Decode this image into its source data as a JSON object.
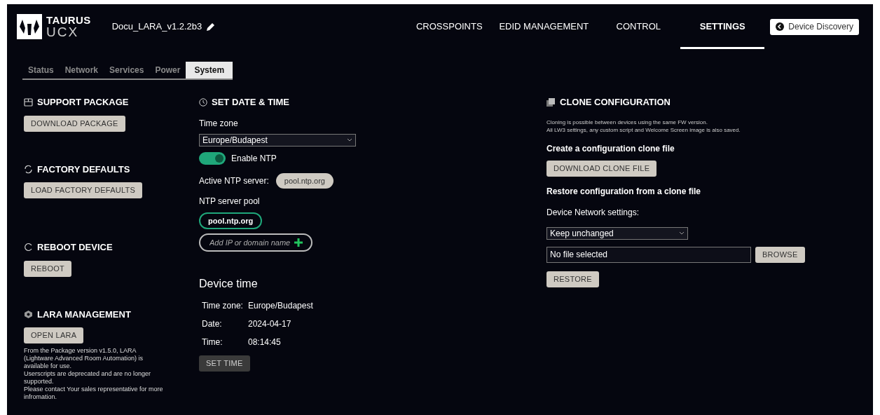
{
  "header": {
    "logo_top": "TAURUS",
    "logo_bottom": "UCX",
    "device_name": "Docu_LARA_v1.2.2b3",
    "nav": [
      {
        "label": "CROSSPOINTS",
        "selected": false
      },
      {
        "label": "EDID MANAGEMENT",
        "selected": false
      },
      {
        "label": "CONTROL",
        "selected": false
      },
      {
        "label": "SETTINGS",
        "selected": true
      }
    ],
    "discovery_button": "Device Discovery"
  },
  "subtabs": [
    {
      "label": "Status",
      "selected": false
    },
    {
      "label": "Network",
      "selected": false
    },
    {
      "label": "Services",
      "selected": false
    },
    {
      "label": "Power",
      "selected": false
    },
    {
      "label": "System",
      "selected": true
    }
  ],
  "left_sections": [
    {
      "kind": "package",
      "title": "SUPPORT PACKAGE",
      "button": "DOWNLOAD PACKAGE"
    },
    {
      "kind": "factory",
      "title": "FACTORY DEFAULTS",
      "button": "LOAD FACTORY DEFAULTS"
    },
    {
      "kind": "reboot",
      "title": "REBOOT DEVICE",
      "button": "REBOOT"
    },
    {
      "kind": "lara",
      "title": "LARA MANAGEMENT",
      "button": "OPEN LARA",
      "note": [
        "From the Package version v1.5.0, LARA (Lightware Advanced Room Automation) is available for use.",
        "Userscripts are deprecated and are no longer supported.",
        "Please contact Your sales representative for more infromation."
      ]
    }
  ],
  "date_time": {
    "title": "SET DATE & TIME",
    "timezone_label": "Time zone",
    "timezone_value": "Europe/Budapest",
    "ntp_toggle": {
      "label": "Enable NTP",
      "on": true
    },
    "active_server_label": "Active NTP server:",
    "active_server": "pool.ntp.org",
    "pool_label": "NTP server pool",
    "pool": [
      "pool.ntp.org"
    ],
    "add_placeholder": "Add IP or domain name",
    "device_time_title": "Device time",
    "device_time": [
      {
        "label": "Time zone:",
        "value": "Europe/Budapest"
      },
      {
        "label": "Date:",
        "value": "2024-04-17"
      },
      {
        "label": "Time:",
        "value": "08:14:45"
      }
    ],
    "set_button": {
      "label": "SET TIME",
      "disabled": true
    }
  },
  "clone": {
    "title": "CLONE CONFIGURATION",
    "description": [
      "Cloning is possible between devices using the same FW version.",
      "All LW3 settings, any custom script and Welcome Screen image is also saved."
    ],
    "create_title": "Create a configuration clone file",
    "download_button": "DOWNLOAD CLONE FILE",
    "restore_title": "Restore configuration from a clone file",
    "network_label": "Device Network settings:",
    "network_value": "Keep unchanged",
    "file_value": "No file selected",
    "browse_button": "BROWSE",
    "restore_button": "RESTORE"
  }
}
